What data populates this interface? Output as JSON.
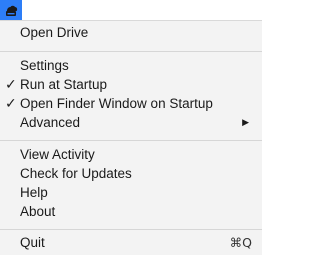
{
  "menubar": {
    "status_icon": "cloud-drive-icon",
    "accent_color": "#2d7ef7"
  },
  "menu": {
    "open_drive": "Open Drive",
    "settings": "Settings",
    "run_at_startup": "Run at Startup",
    "open_finder_on_startup": "Open Finder Window on Startup",
    "advanced": "Advanced",
    "view_activity": "View Activity",
    "check_for_updates": "Check for Updates",
    "help": "Help",
    "about": "About",
    "quit": "Quit",
    "quit_shortcut": "⌘Q",
    "checkmark": "✓",
    "submenu_arrow": "▶"
  }
}
